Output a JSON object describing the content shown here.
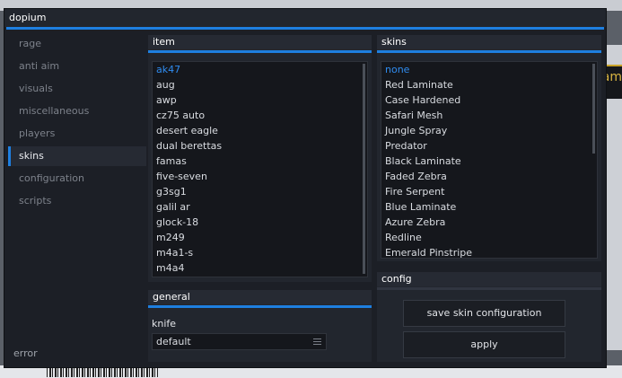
{
  "background": {
    "right_text": "am"
  },
  "window": {
    "title": "dopium",
    "accent_color": "#1e7fe0"
  },
  "sidebar": {
    "items": [
      {
        "label": "rage",
        "active": false
      },
      {
        "label": "anti aim",
        "active": false
      },
      {
        "label": "visuals",
        "active": false
      },
      {
        "label": "miscellaneous",
        "active": false
      },
      {
        "label": "players",
        "active": false
      },
      {
        "label": "skins",
        "active": true
      },
      {
        "label": "configuration",
        "active": false
      },
      {
        "label": "scripts",
        "active": false
      }
    ],
    "status": "error"
  },
  "item_panel": {
    "title": "item",
    "items": [
      "ak47",
      "aug",
      "awp",
      "cz75 auto",
      "desert eagle",
      "dual berettas",
      "famas",
      "five-seven",
      "g3sg1",
      "galil ar",
      "glock-18",
      "m249",
      "m4a1-s",
      "m4a4"
    ],
    "selected": "ak47"
  },
  "skins_panel": {
    "title": "skins",
    "items": [
      "none",
      "Red Laminate",
      "Case Hardened",
      "Safari Mesh",
      "Jungle Spray",
      "Predator",
      "Black Laminate",
      "Faded Zebra",
      "Fire Serpent",
      "Blue Laminate",
      "Azure Zebra",
      "Redline",
      "Emerald Pinstripe"
    ],
    "selected": "none"
  },
  "general_panel": {
    "title": "general",
    "knife_label": "knife",
    "knife_value": "default"
  },
  "config_panel": {
    "title": "config",
    "save_label": "save skin configuration",
    "apply_label": "apply"
  }
}
